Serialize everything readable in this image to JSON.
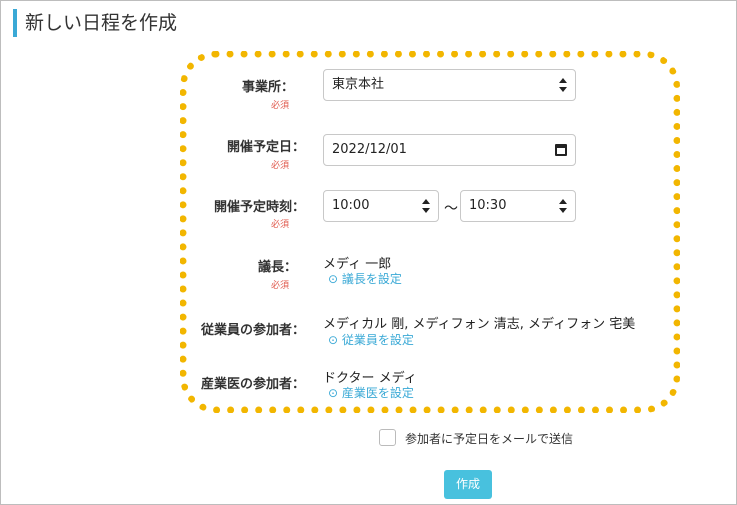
{
  "page": {
    "title": "新しい日程を作成"
  },
  "form": {
    "office": {
      "label": "事業所：",
      "required": "必須",
      "value": "東京本社"
    },
    "date": {
      "label": "開催予定日：",
      "required": "必須",
      "value": "2022/12/01"
    },
    "time": {
      "label": "開催予定時刻：",
      "required": "必須",
      "start": "10:00",
      "separator": "～",
      "end": "10:30"
    },
    "chair": {
      "label": "議長：",
      "required": "必須",
      "value": "メディ 一郎",
      "link": "⊙ 議長を設定"
    },
    "employees": {
      "label": "従業員の参加者：",
      "value": "メディカル 剛, メディフォン 清志, メディフォン 宅美",
      "link": "⊙ 従業員を設定"
    },
    "doctor": {
      "label": "産業医の参加者：",
      "value": "ドクター メディ",
      "link": "⊙ 産業医を設定"
    },
    "notify": {
      "label": "参加者に予定日をメールで送信",
      "checked": false
    },
    "submit_label": "作成"
  },
  "colors": {
    "accent": "#3aa9d6",
    "highlight": "#f2b600",
    "required": "#e0574a",
    "button": "#48c1de"
  }
}
